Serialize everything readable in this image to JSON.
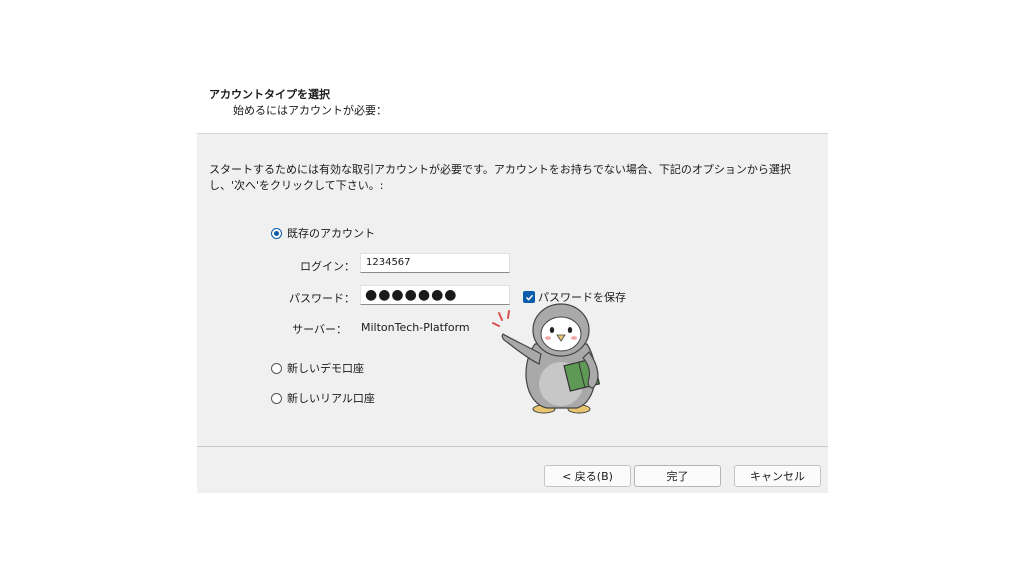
{
  "header": {
    "title": "アカウントタイプを選択",
    "subtitle": "始めるにはアカウントが必要："
  },
  "description": "スタートするためには有効な取引アカウントが必要です。アカウントをお持ちでない場合、下記のオプションから選択し、'次へ'をクリックして下さい。:",
  "options": {
    "existing": "既存のアカウント",
    "demo": "新しいデモ口座",
    "real": "新しいリアル口座",
    "selected": "existing"
  },
  "login": {
    "label": "ログイン：",
    "value": "1234567"
  },
  "password": {
    "label": "パスワード：",
    "value": "●●●●●●●",
    "save_label": "パスワードを保存",
    "save_checked": true
  },
  "server": {
    "label": "サーバー：",
    "value": "MiltonTech-Platform"
  },
  "buttons": {
    "back": "< 戻る(B)",
    "finish": "完了",
    "cancel": "キャンセル"
  },
  "colors": {
    "accent": "#0b5cab",
    "dialog_bg": "#f0f0f0"
  }
}
